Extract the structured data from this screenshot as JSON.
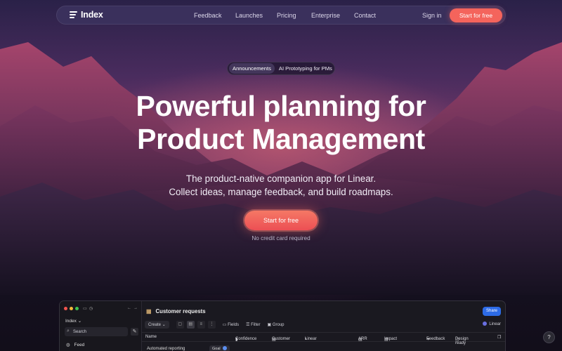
{
  "nav": {
    "logo": "Index",
    "links": [
      "Feedback",
      "Launches",
      "Pricing",
      "Enterprise",
      "Contact"
    ],
    "signin": "Sign in",
    "cta": "Start for free"
  },
  "badge": {
    "tag": "Announcements",
    "text": "AI Prototyping for PMs"
  },
  "hero": {
    "line1": "Powerful planning for",
    "line2": "Product Management",
    "sub1": "The product-native companion app for Linear.",
    "sub2": "Collect ideas, manage feedback, and build roadmaps.",
    "cta": "Start for free",
    "note": "No credit card required"
  },
  "app": {
    "workspace": "Index",
    "search": "Search",
    "feed": "Feed",
    "title": "Customer requests",
    "share": "Share",
    "toolbar": {
      "create": "Create",
      "fields": "Fields",
      "filter": "Filter",
      "group": "Group",
      "linear": "Linear"
    },
    "columns": [
      "Name",
      "Confidence",
      "Customer",
      "Linear",
      "ARR",
      "Impact",
      "Feedback",
      "Design ready"
    ],
    "rows": [
      {
        "name": "Automated reporting",
        "tag": "Goal"
      }
    ]
  },
  "help": "?"
}
